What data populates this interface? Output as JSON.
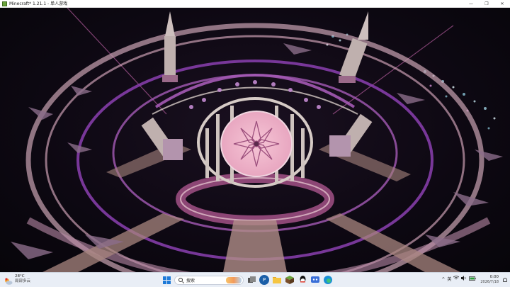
{
  "window": {
    "title": "Minecraft* 1.21.1 - 单人游戏",
    "minimize_glyph": "—",
    "maximize_glyph": "❐",
    "close_glyph": "✕"
  },
  "game": {
    "scene": "minecraft-build-view",
    "accent_colors": {
      "pink": "#e8a6c0",
      "purple": "#8b3fb0",
      "quartz": "#d6cbc6"
    }
  },
  "taskbar": {
    "weather": {
      "temp": "28°C",
      "desc": "局部多云"
    },
    "search": {
      "label": "搜索"
    },
    "apps": [
      {
        "name": "start-button",
        "icon": "windows-icon"
      },
      {
        "name": "task-view",
        "icon": "task-view-icon"
      },
      {
        "name": "app-p",
        "icon": "p-app-icon"
      },
      {
        "name": "file-explorer",
        "icon": "folder-icon"
      },
      {
        "name": "minecraft-launcher",
        "icon": "minecraft-icon"
      },
      {
        "name": "qq",
        "icon": "qq-icon"
      },
      {
        "name": "wechat-like",
        "icon": "chat-icon"
      },
      {
        "name": "edge",
        "icon": "edge-icon"
      }
    ],
    "tray": {
      "chevron": "^",
      "ime": "英",
      "time": "0:00",
      "date": "2026/7/18"
    }
  }
}
